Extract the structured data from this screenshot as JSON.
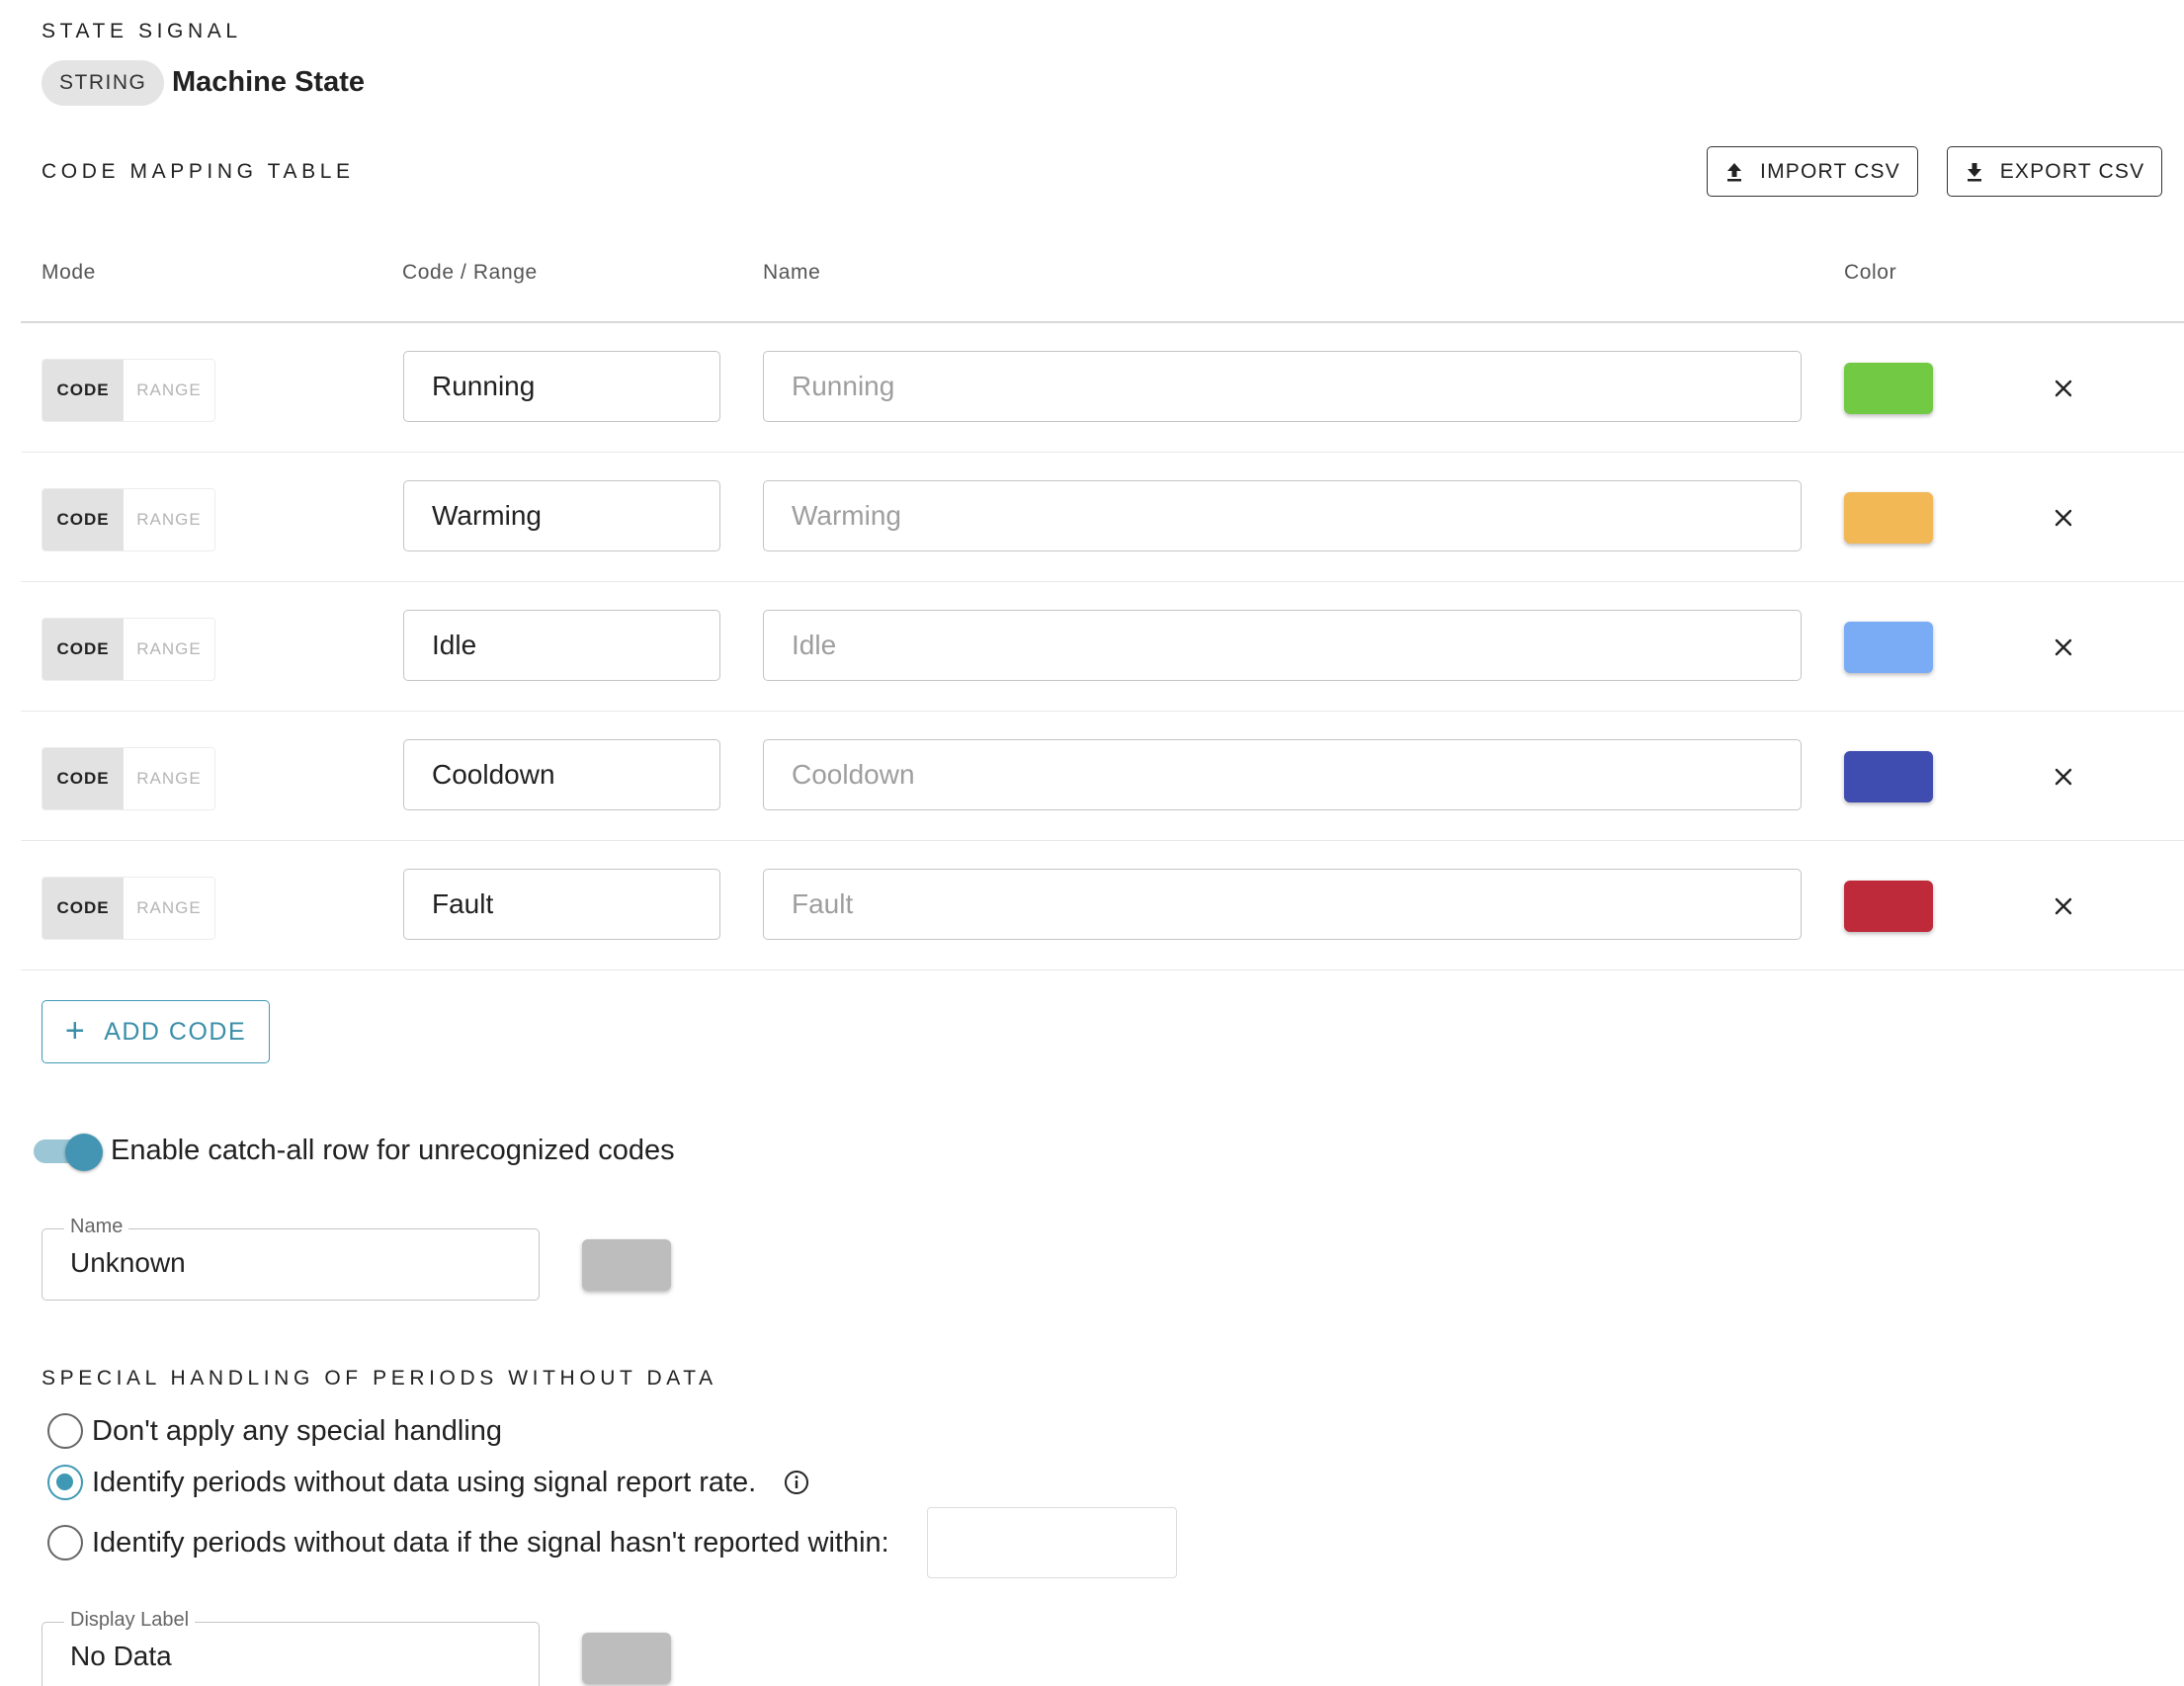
{
  "state_signal": {
    "section_title": "STATE SIGNAL",
    "type_chip": "STRING",
    "signal_name": "Machine State"
  },
  "mapping": {
    "section_title": "CODE MAPPING TABLE",
    "import_label": "IMPORT CSV",
    "export_label": "EXPORT CSV",
    "columns": {
      "mode": "Mode",
      "code": "Code / Range",
      "name": "Name",
      "color": "Color"
    },
    "mode_code_label": "CODE",
    "mode_range_label": "RANGE",
    "rows": [
      {
        "mode": "CODE",
        "code": "Running",
        "name_placeholder": "Running",
        "color": "#72c944"
      },
      {
        "mode": "CODE",
        "code": "Warming",
        "name_placeholder": "Warming",
        "color": "#f2b856"
      },
      {
        "mode": "CODE",
        "code": "Idle",
        "name_placeholder": "Idle",
        "color": "#7aacf5"
      },
      {
        "mode": "CODE",
        "code": "Cooldown",
        "name_placeholder": "Cooldown",
        "color": "#3f4db0"
      },
      {
        "mode": "CODE",
        "code": "Fault",
        "name_placeholder": "Fault",
        "color": "#bf2a3b"
      }
    ],
    "add_label": "ADD CODE"
  },
  "catch_all": {
    "enabled": true,
    "label": "Enable catch-all row for unrecognized codes",
    "name_legend": "Name",
    "name_value": "Unknown",
    "color": "#bdbdbd"
  },
  "no_data": {
    "section_title": "SPECIAL HANDLING OF PERIODS WITHOUT DATA",
    "options": [
      {
        "label": "Don't apply any special handling",
        "selected": false
      },
      {
        "label": "Identify periods without data using signal report rate.",
        "selected": true
      },
      {
        "label": "Identify periods without data if the signal hasn't reported within:",
        "selected": false
      }
    ],
    "within_value": "",
    "display_legend": "Display Label",
    "display_value": "No Data",
    "color": "#bdbdbd"
  },
  "colors": {
    "accent": "#3f98b4"
  }
}
